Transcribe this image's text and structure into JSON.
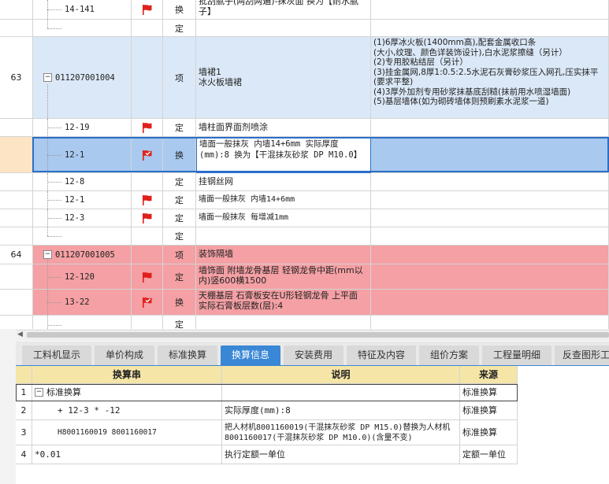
{
  "grid": {
    "rows": [
      {
        "num": "",
        "code": "14-141",
        "flag": "red",
        "unit": "换",
        "desc": "批刮腻子(两刮两遍)-抹灰面  换为【耐水腻子】",
        "feature": ""
      },
      {
        "num": "",
        "code": "",
        "flag": "",
        "unit": "定",
        "desc": "",
        "feature": ""
      },
      {
        "num": "63",
        "code": "011207001004",
        "flag": "",
        "unit": "项",
        "desc": "墙裙1\n冰火板墙裙",
        "feature": "(1)6厚冰火板(1400mm高),配套金属收口条\n(大小,纹理、颜色详装饰设计),白水泥浆擦缝（另计）\n(2)专用胶粘结层（另计）\n(3)挂金属网,8厚1:0.5:2.5水泥石灰膏砂浆压入网孔,压实抹平(要求平整)\n(4)3厚外加剂专用砂浆抹基底刮糙(抹前用水喷湿墙面)\n(5)基层墙体(如为砌砖墙体则预刷素水泥浆一道)"
      },
      {
        "num": "",
        "code": "12-19",
        "flag": "red",
        "unit": "定",
        "desc": "墙柱面界面剂喷涂",
        "feature": ""
      },
      {
        "num": "",
        "code": "12-1",
        "flag": "check",
        "unit": "换",
        "desc": "墙面一般抹灰 内墙14+6mm  实际厚度(mm):8  换为【干混抹灰砂浆 DP M10.0】",
        "feature": ""
      },
      {
        "num": "",
        "code": "12-8",
        "flag": "",
        "unit": "定",
        "desc": "挂钢丝网",
        "feature": ""
      },
      {
        "num": "",
        "code": "12-1",
        "flag": "red",
        "unit": "定",
        "desc": "墙面一般抹灰 内墙14+6mm",
        "feature": ""
      },
      {
        "num": "",
        "code": "12-3",
        "flag": "red",
        "unit": "定",
        "desc": "墙面一般抹灰 每增减1mm",
        "feature": ""
      },
      {
        "num": "",
        "code": "",
        "flag": "",
        "unit": "定",
        "desc": "",
        "feature": ""
      },
      {
        "num": "64",
        "code": "011207001005",
        "flag": "",
        "unit": "项",
        "desc": "装饰隔墙",
        "feature": ""
      },
      {
        "num": "",
        "code": "12-120",
        "flag": "red",
        "unit": "定",
        "desc": "墙饰面 附墙龙骨基层 轻钢龙骨中距(mm以内)竖600横1500",
        "feature": ""
      },
      {
        "num": "",
        "code": "13-22",
        "flag": "check",
        "unit": "换",
        "desc": "天棚基层 石膏板安在U形轻钢龙骨 上平面  实际石膏板层数(层):4",
        "feature": ""
      },
      {
        "num": "",
        "code": "",
        "flag": "",
        "unit": "定",
        "desc": "",
        "feature": ""
      }
    ]
  },
  "tabs": [
    "工料机显示",
    "单价构成",
    "标准换算",
    "换算信息",
    "安装费用",
    "特征及内容",
    "组价方案",
    "工程量明细",
    "反查图形工"
  ],
  "active_tab": "换算信息",
  "bottom": {
    "headers": {
      "formula": "换算串",
      "desc": "说明",
      "source": "来源"
    },
    "rows": [
      {
        "n": "1",
        "formula": "标准换算",
        "desc": "",
        "source": "标准换算"
      },
      {
        "n": "2",
        "formula": "+ 12-3 * -12",
        "desc": "实际厚度(mm):8",
        "source": "标准换算"
      },
      {
        "n": "3",
        "formula": "H8001160019 8001160017",
        "desc": "把人材机8001160019(干混抹灰砂浆 DP M15.0)替换为人材机8001160017(干混抹灰砂浆 DP M10.0)(含量不变)",
        "source": "标准换算"
      },
      {
        "n": "4",
        "formula": "*0.01",
        "desc": "执行定额一单位",
        "source": "定额一单位"
      }
    ]
  },
  "colors": {
    "accent": "#3a87d6",
    "flag": "#e0201a",
    "blue_row": "#dbe8f7",
    "red_row": "#f4a0a4",
    "header": "#f5e6a8"
  }
}
